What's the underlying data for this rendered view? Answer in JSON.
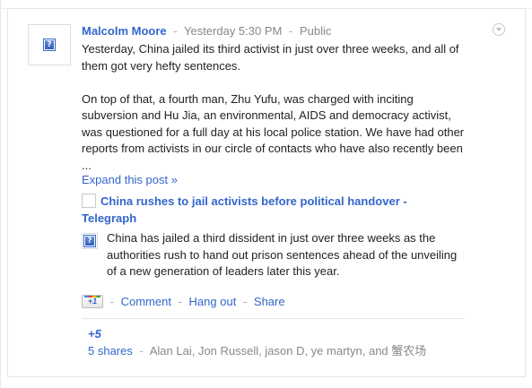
{
  "post": {
    "author": "Malcolm Moore",
    "timestamp": "Yesterday 5:30 PM",
    "visibility": "Public",
    "paragraph_1": "Yesterday, China jailed its third activist in just over three weeks, and all of them got very hefty sentences.",
    "paragraph_2": "On top of that, a fourth man, Zhu Yufu, was charged with inciting subversion and Hu Jia, an environmental, AIDS and democracy activist, was questioned for a full day at his local police station. We have had other reports from activists in our circle of contacts who have also recently been ...",
    "expand_label": "Expand this post »"
  },
  "attachment": {
    "title": "China rushes to jail activists before political handover - Telegraph",
    "description": "China has jailed a third dissident in just over three weeks as the authorities rush to hand out prison sentences ahead of the unveiling of a new generation of leaders later this year."
  },
  "actions": {
    "plusone_label": "+1",
    "separator": "-",
    "comment": "Comment",
    "hangout": "Hang out",
    "share": "Share"
  },
  "stats": {
    "plus_count": "+5",
    "shares_label": "5 shares",
    "sharers": "Alan Lai, Jon Russell, jason D, ye martyn, and 蟹农场"
  },
  "icons": {
    "avatar": "broken-image-icon",
    "thumbnail": "broken-image-icon",
    "options": "chevron-down-icon"
  },
  "colors": {
    "link": "#3366cc",
    "meta": "#888888",
    "border": "#e5e5e5"
  }
}
